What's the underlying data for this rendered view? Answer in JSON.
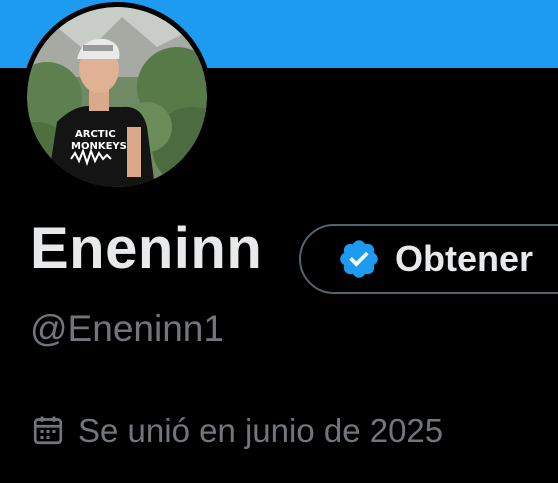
{
  "profile": {
    "banner_color": "#1d9bf0",
    "avatar_icon": "profile-photo",
    "display_name": "Eneninn",
    "handle": "@Eneninn1",
    "joined_icon": "calendar-icon",
    "joined_text": "Se unió en junio de 2025"
  },
  "verify": {
    "badge_icon": "verified-badge-icon",
    "label": "Obtener",
    "badge_color": "#1d9bf0"
  },
  "colors": {
    "background": "#000000",
    "primary_text": "#e7e9ea",
    "secondary_text": "#71767b",
    "border": "#536471"
  },
  "avatar_shirt_text": {
    "line1": "ARCTIC",
    "line2": "MONKEYS"
  }
}
